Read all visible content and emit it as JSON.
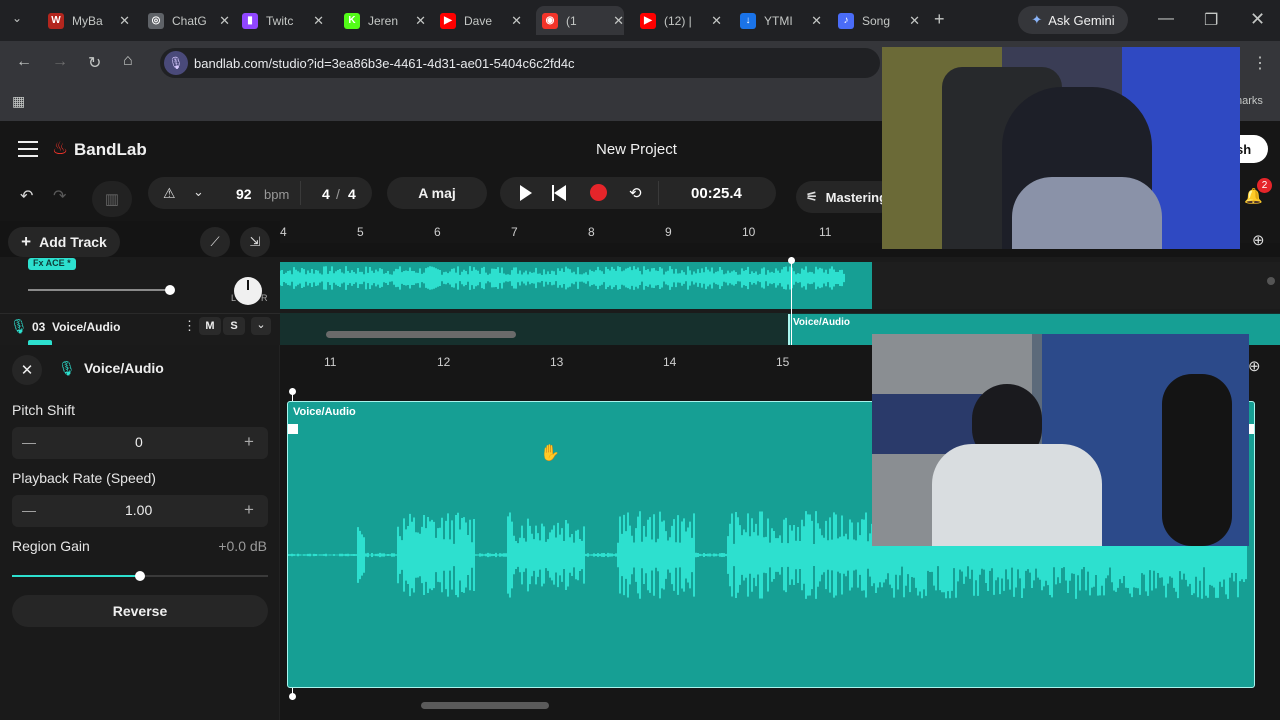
{
  "browser": {
    "tabs": [
      {
        "label": "MyBa",
        "icon": "mybandlab-favicon",
        "color": "#b3261e",
        "glyph": "W"
      },
      {
        "label": "ChatG",
        "icon": "chatgpt-favicon",
        "color": "#5f6368",
        "glyph": "◎"
      },
      {
        "label": "Twitc",
        "icon": "twitch-favicon",
        "color": "#9146ff",
        "glyph": "▮"
      },
      {
        "label": "Jeren",
        "icon": "kick-favicon",
        "color": "#53fc18",
        "glyph": "K"
      },
      {
        "label": "Dave",
        "icon": "youtube-favicon",
        "color": "#ff0000",
        "glyph": "▶"
      },
      {
        "label": "(1",
        "icon": "bandlab-favicon",
        "color": "#f2342a",
        "glyph": "◉"
      },
      {
        "label": "(12) |",
        "icon": "youtube-favicon",
        "color": "#ff0000",
        "glyph": "▶"
      },
      {
        "label": "YTMI",
        "icon": "ytmp3-favicon",
        "color": "#1a73e8",
        "glyph": "↓"
      },
      {
        "label": "Song",
        "icon": "song-favicon",
        "color": "#4a6cf7",
        "glyph": "♪"
      }
    ],
    "ask_gemini": "Ask Gemini",
    "url": "bandlab.com/studio?id=3ea86b3e-4461-4d31-ae01-5404c6c2fd4c",
    "bookmarks_partial": "harks"
  },
  "app": {
    "brand": "BandLab",
    "project_title": "New Project",
    "publish_partial": "sh",
    "notification_count": "2"
  },
  "transport": {
    "tempo": "92",
    "tempo_unit": "bpm",
    "time_sig_top": "4",
    "time_sig_sep": "/",
    "time_sig_bottom": "4",
    "key": "A maj",
    "time": "00:25.4",
    "mastering": "Mastering"
  },
  "toolbar": {
    "add_track": "Add Track"
  },
  "ruler_top": [
    "4",
    "5",
    "6",
    "7",
    "8",
    "9",
    "10",
    "11"
  ],
  "tracks": {
    "fx_badge": "Fx ACE *",
    "pan_left": "L",
    "pan_right": "R",
    "track3_name": "03  Voice/Audio",
    "mute": "M",
    "solo": "S",
    "region_label": "Voice/Audio"
  },
  "editor": {
    "panel_title": "Voice/Audio",
    "pitch_label": "Pitch Shift",
    "pitch_value": "0",
    "rate_label": "Playback Rate (Speed)",
    "rate_value": "1.00",
    "gain_label": "Region Gain",
    "gain_value": "+0.0 dB",
    "gain_level": 0.5,
    "reverse": "Reverse",
    "ruler": [
      "11",
      "12",
      "13",
      "14",
      "15"
    ],
    "region_label": "Voice/Audio"
  },
  "colors": {
    "accent": "#2de0cf",
    "region": "#169f94",
    "record": "#e5252a",
    "brand": "#f2342a"
  }
}
